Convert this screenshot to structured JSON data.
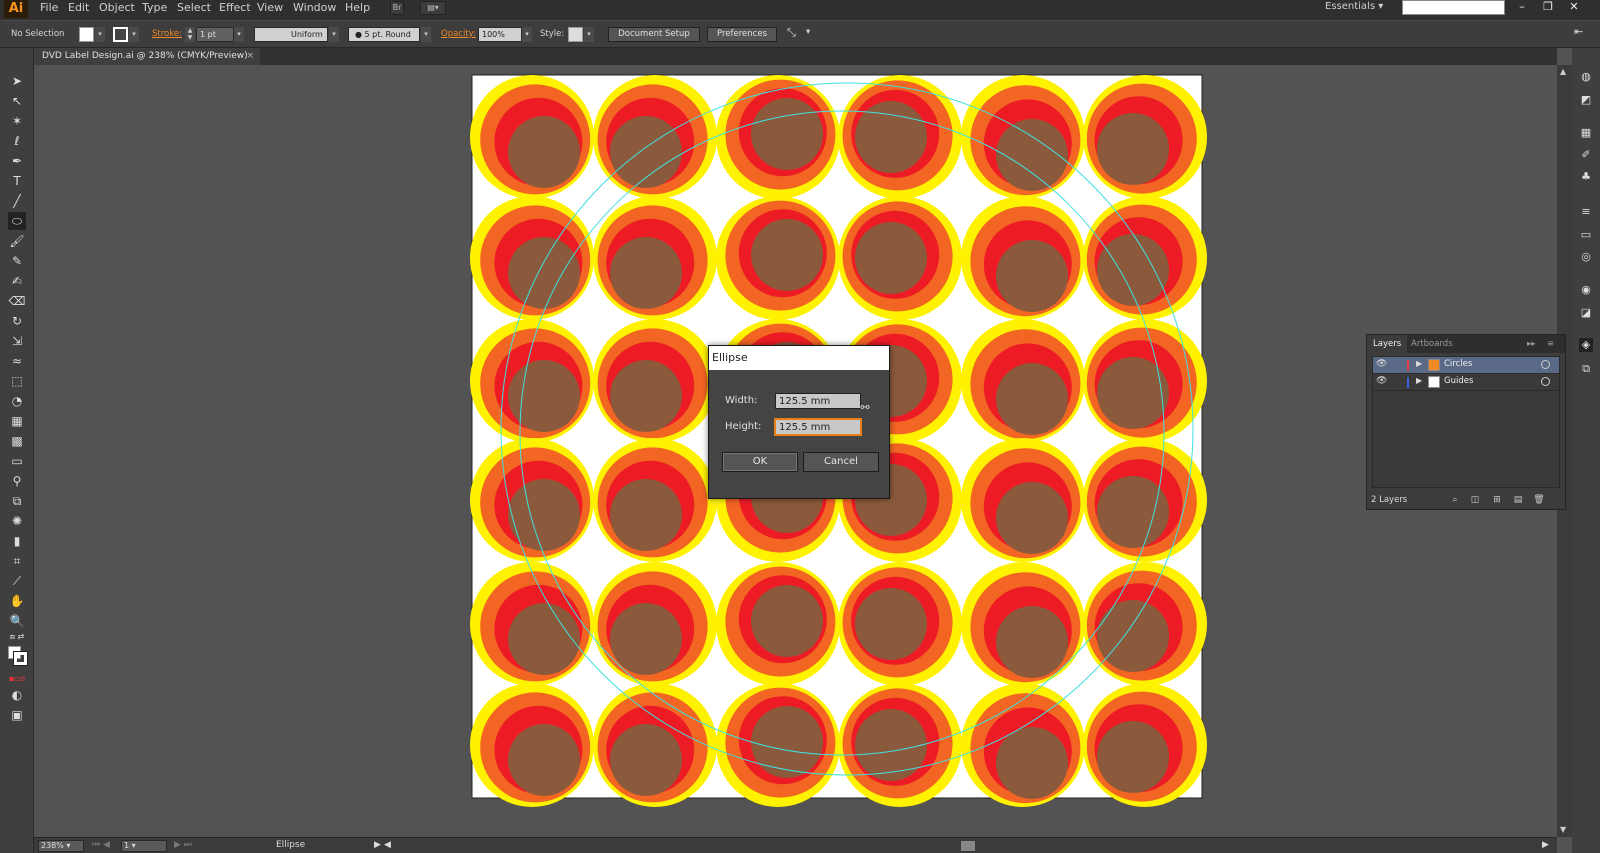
{
  "app": {
    "logo": "Ai"
  },
  "menu": [
    "File",
    "Edit",
    "Object",
    "Type",
    "Select",
    "Effect",
    "View",
    "Window",
    "Help"
  ],
  "menubar": {
    "bridge_label": "Br",
    "arrange_label": "▤▾",
    "workspace": "Essentials"
  },
  "control_bar": {
    "selection": "No Selection",
    "stroke_label": "Stroke:",
    "stroke_weight": "1 pt",
    "stroke_profile": "Uniform",
    "brush": "5 pt. Round",
    "opacity_label": "Opacity:",
    "opacity_value": "100%",
    "style_label": "Style:",
    "document_setup": "Document Setup",
    "preferences": "Preferences"
  },
  "document_tab": {
    "title": "DVD Label Design.ai @ 238% (CMYK/Preview)",
    "close": "×"
  },
  "dialog": {
    "title": "Ellipse",
    "width_label": "Width:",
    "width_value": "125.5 mm",
    "height_label": "Height:",
    "height_value": "125.5 mm",
    "ok": "OK",
    "cancel": "Cancel"
  },
  "layers_panel": {
    "tabs": [
      "Layers",
      "Artboards"
    ],
    "layers": [
      {
        "name": "Circles",
        "color": "#e04040",
        "selected": true
      },
      {
        "name": "Guides",
        "color": "#4060e0",
        "selected": false
      }
    ],
    "count": "2 Layers"
  },
  "status_bar": {
    "zoom": "238%",
    "artboard": "1",
    "tool": "Ellipse"
  },
  "colors": {
    "yellow": "#fff200",
    "orange": "#f26522",
    "red": "#ed1c24",
    "brown": "#8b5a3c",
    "guide": "#40e0e0"
  }
}
